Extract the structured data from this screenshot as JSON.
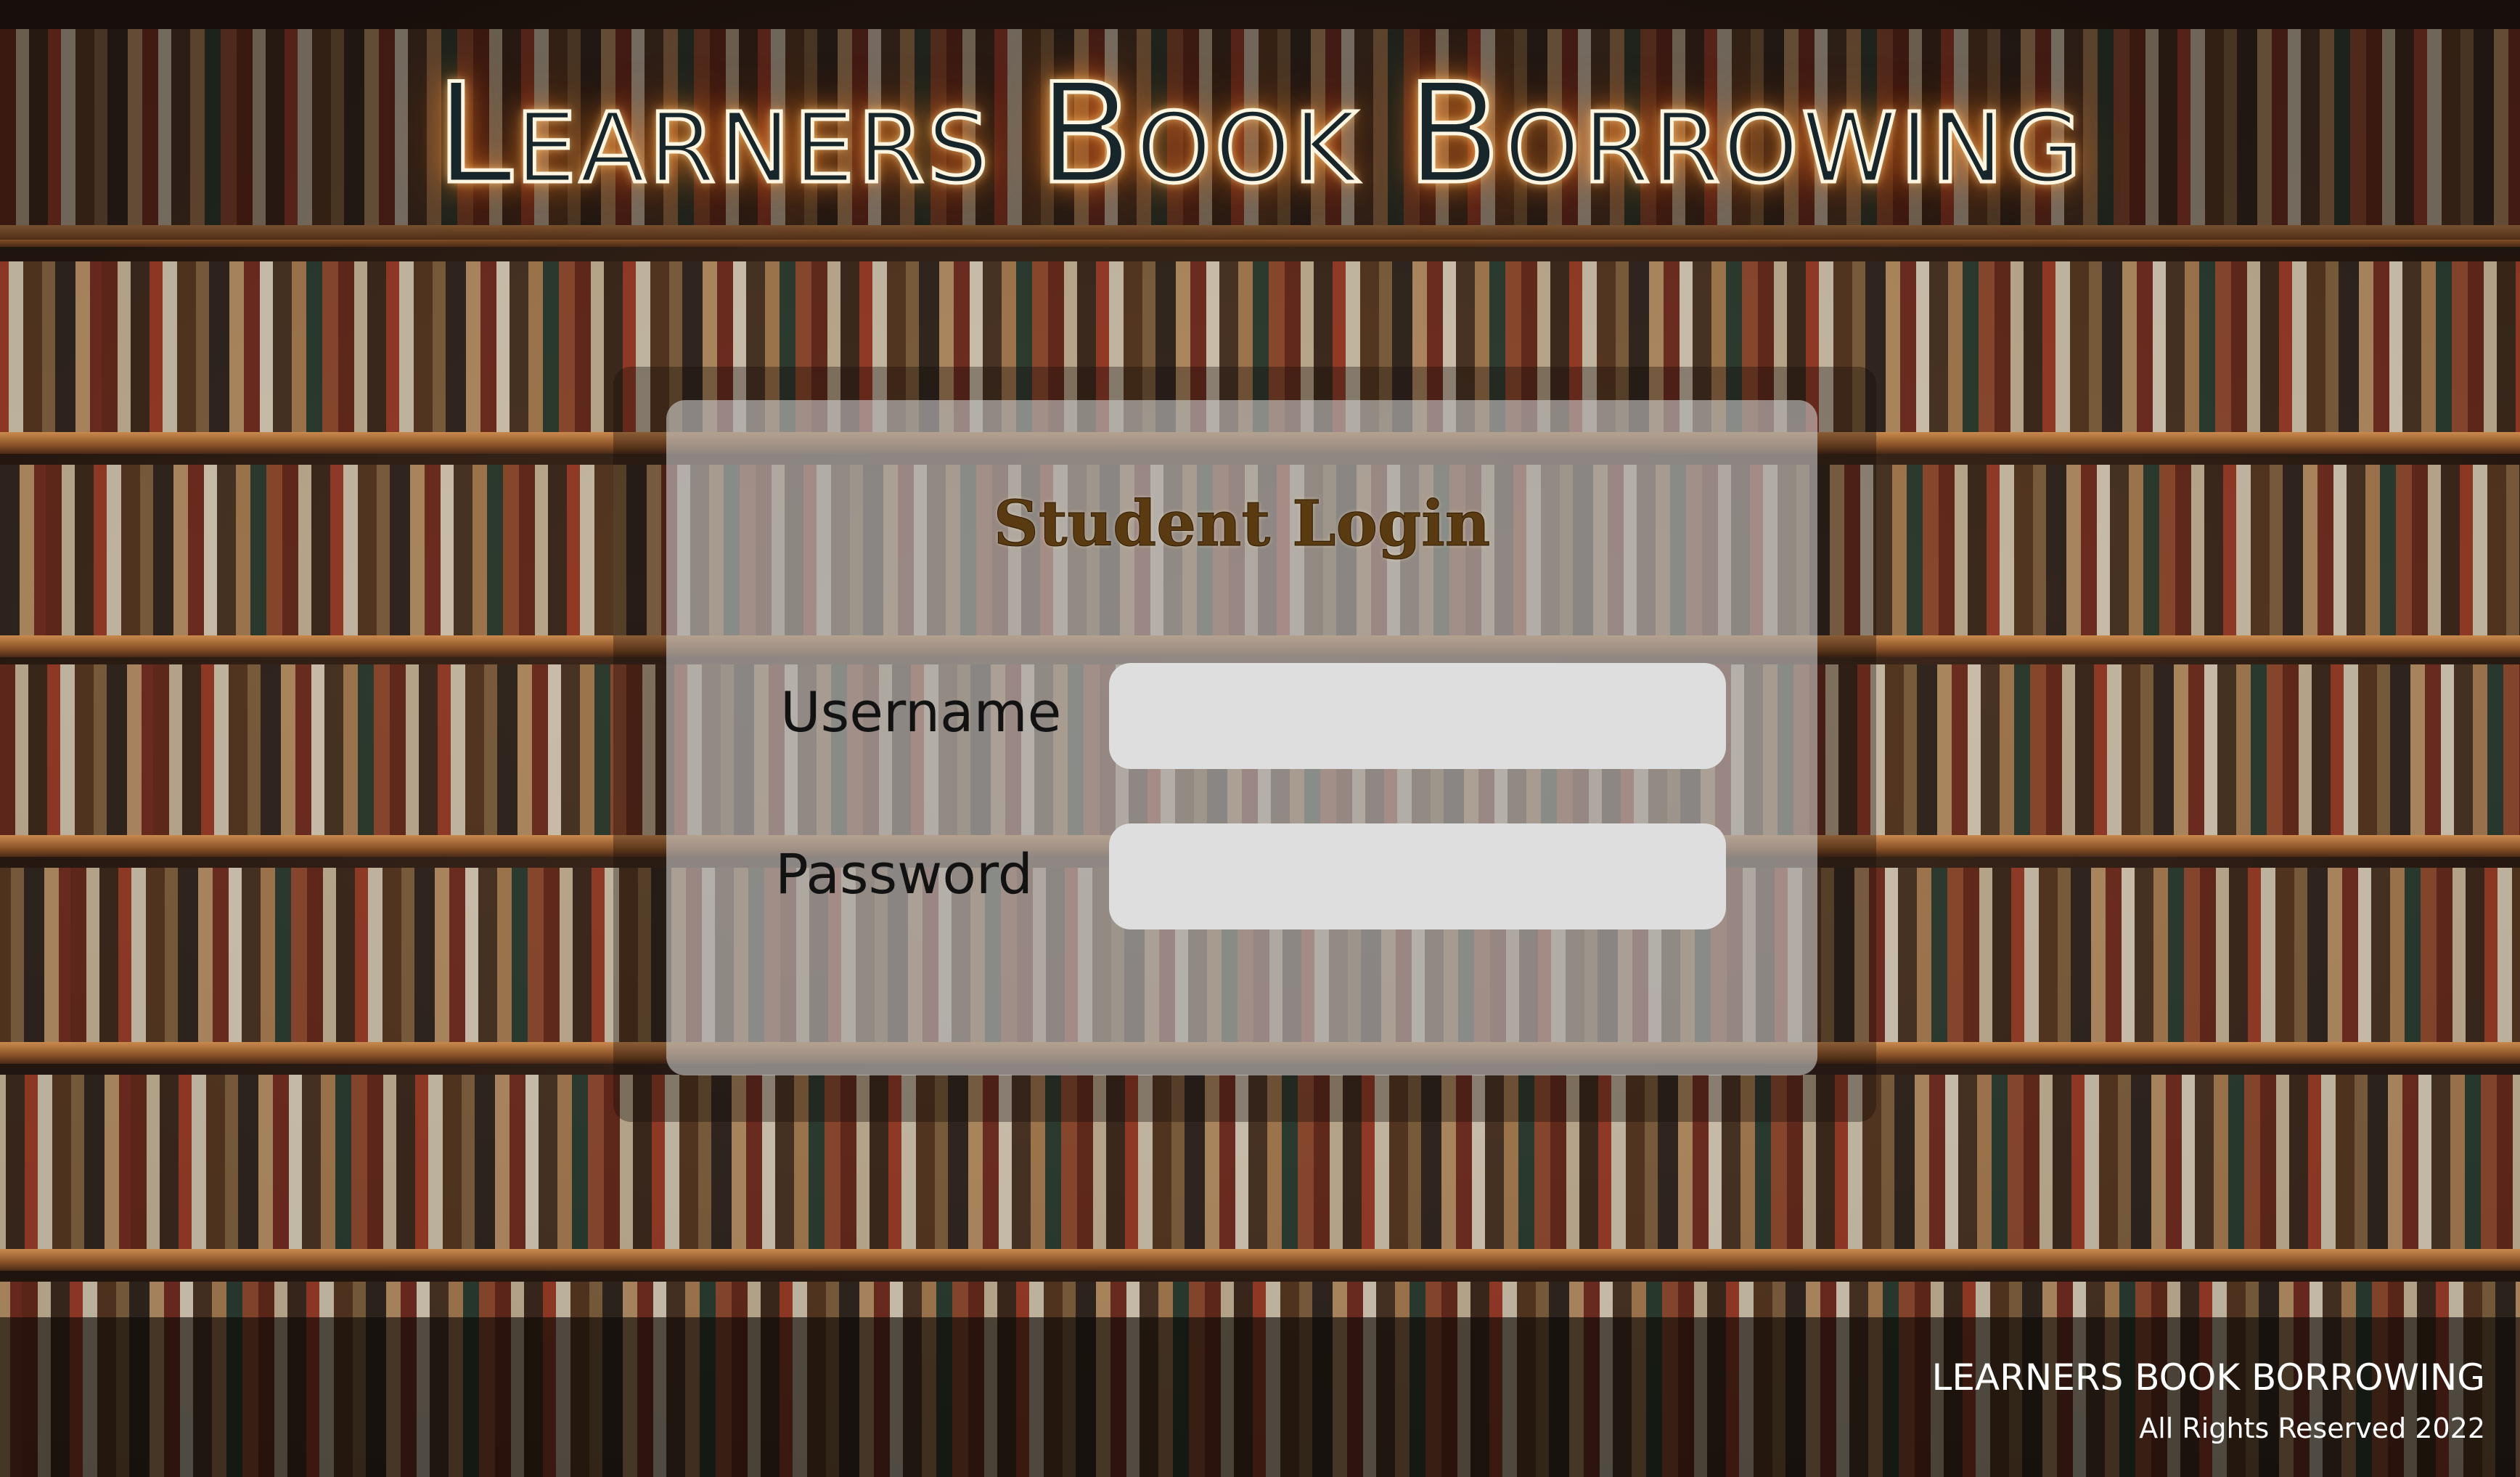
{
  "header": {
    "title": "Learners Book Borrowing"
  },
  "login": {
    "title": "Student Login",
    "username_label": "Username",
    "username_value": "",
    "password_label": "Password",
    "password_value": ""
  },
  "footer": {
    "brand": "LEARNERS BOOK BORROWING",
    "copyright": "All Rights Reserved 2022"
  },
  "colors": {
    "title_glow": "#ff8c28",
    "card_title": "#5a3a10",
    "input_background": "#dedede"
  }
}
